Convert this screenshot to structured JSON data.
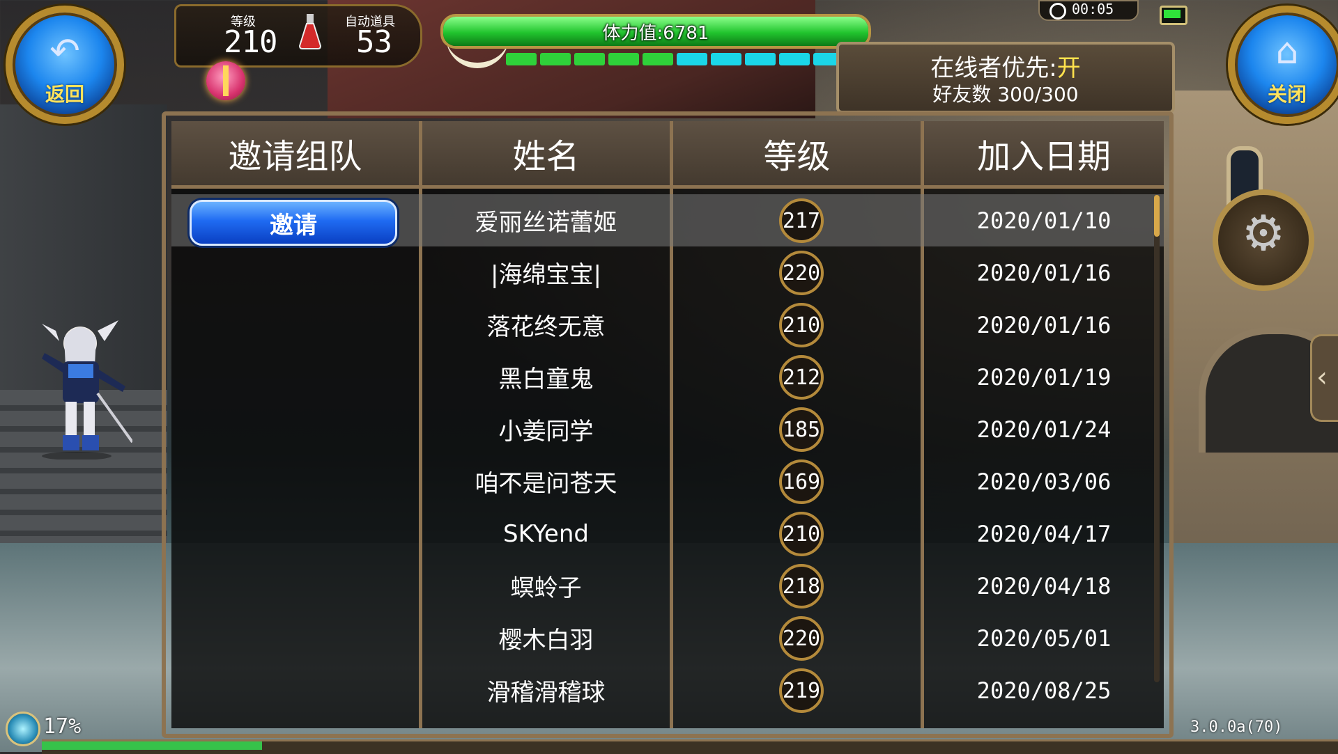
{
  "hud": {
    "level_label": "等级",
    "level_value": "210",
    "auto_item_label": "自动道具",
    "auto_item_value": "53",
    "stamina_text": "体力值:6781",
    "stamina_percent": 100,
    "energy_segments": [
      "#2fd13a",
      "#2fd13a",
      "#2fd13a",
      "#2fd13a",
      "#2fd13a",
      "#1bd6e8",
      "#1bd6e8",
      "#1bd6e8",
      "#1bd6e8",
      "#1bd6e8"
    ],
    "clock": "00:05"
  },
  "buttons": {
    "back_label": "返回",
    "close_label": "关闭"
  },
  "status": {
    "online_priority_label": "在线者优先:",
    "online_priority_value": "开",
    "friend_count": "好友数 300/300"
  },
  "table": {
    "headers": [
      "邀请组队",
      "姓名",
      "等级",
      "加入日期"
    ],
    "invite_label": "邀请",
    "rows": [
      {
        "name": "爱丽丝诺蕾姬",
        "level": "217",
        "date": "2020/01/10"
      },
      {
        "name": "|海绵宝宝|",
        "level": "220",
        "date": "2020/01/16"
      },
      {
        "name": "落花终无意",
        "level": "210",
        "date": "2020/01/16"
      },
      {
        "name": "黑白童鬼",
        "level": "212",
        "date": "2020/01/19"
      },
      {
        "name": "小姜同学",
        "level": "185",
        "date": "2020/01/24"
      },
      {
        "name": "咱不是问苍天",
        "level": "169",
        "date": "2020/03/06"
      },
      {
        "name": "SKYend",
        "level": "210",
        "date": "2020/04/17"
      },
      {
        "name": "螟蛉子",
        "level": "218",
        "date": "2020/04/18"
      },
      {
        "name": "樱木白羽",
        "level": "220",
        "date": "2020/05/01"
      },
      {
        "name": "滑稽滑稽球",
        "level": "219",
        "date": "2020/08/25"
      }
    ]
  },
  "footer": {
    "exp_percent_text": "17%",
    "exp_percent": 17,
    "version": "3.0.0a(70)"
  },
  "colors": {
    "accent_gold": "#b68b2e",
    "button_blue": "#1f6bf2",
    "highlight_yellow": "#ffe24d"
  }
}
